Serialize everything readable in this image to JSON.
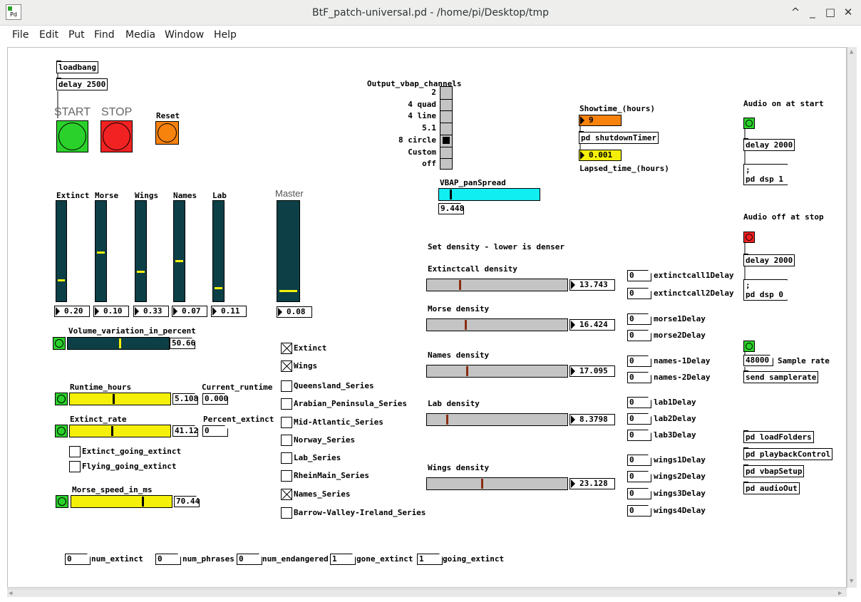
{
  "window": {
    "title": "BtF_patch-universal.pd  - /home/pi/Desktop/tmp",
    "app_icon_label": "Pd",
    "controls": [
      "^",
      "_",
      "□",
      "✕"
    ]
  },
  "menu": [
    "File",
    "Edit",
    "Put",
    "Find",
    "Media",
    "Window",
    "Help"
  ],
  "objects": {
    "loadbang": "loadbang",
    "delay2500": "delay 2500",
    "shutdown": "pd shutdownTimer",
    "delay_on": "delay 2000",
    "delay_off": "delay 2000",
    "send_sr": "send samplerate",
    "loadfolders": "pd loadFolders",
    "playback": "pd playbackControl",
    "vbapsetup": "pd vbapSetup",
    "audioout": "pd audioOut"
  },
  "labels": {
    "start": "START",
    "stop": "STOP",
    "reset": "Reset",
    "master": "Master",
    "output_vbap": "Output_vbap_channels",
    "showtime": "Showtime_(hours)",
    "lapsed": "Lapsed_time_(hours)",
    "audio_on": "Audio on at start",
    "audio_off": "Audio off at stop",
    "sample_rate": "Sample rate",
    "vbap_spread": "VBAP_panSpread",
    "set_density": "Set density - lower is denser",
    "volume_var": "Volume_variation_in_percent",
    "runtime_hours": "Runtime_hours",
    "current_runtime": "Current_runtime",
    "extinct_rate": "Extinct_rate",
    "percent_extinct": "Percent_extinct",
    "morse_speed": "Morse_speed_in_ms",
    "extinct_going": "Extinct_going_extinct",
    "flying_going": "Flying_going_extinct"
  },
  "messages": {
    "dsp_on_1": ";",
    "dsp_on_2": "pd dsp 1",
    "dsp_off_1": ";",
    "dsp_off_2": "pd dsp 0"
  },
  "radio_labels": [
    "2",
    "4 quad",
    "4 line",
    "5.1",
    "8 circle",
    "Custom",
    "off"
  ],
  "radio_selected": 4,
  "showtime_value": "9",
  "lapsed_value": "0.001",
  "vbap_spread_value": "9.448",
  "sample_rate_value": "48000",
  "vsliders": [
    {
      "name": "Extinct",
      "value": "0.20",
      "level": 0.2
    },
    {
      "name": "Morse",
      "value": "0.10",
      "level": 0.49
    },
    {
      "name": "Wings",
      "value": "0.33",
      "level": 0.29
    },
    {
      "name": "Names",
      "value": "0.07",
      "level": 0.4
    },
    {
      "name": "Lab",
      "value": "0.11",
      "level": 0.12
    }
  ],
  "master": {
    "value": "0.08",
    "level": 0.09
  },
  "volume_var_value": "50.66",
  "runtime_value": "5.108",
  "current_runtime_value": "0.000",
  "extinct_rate_value": "41.12",
  "percent_extinct_value": "0",
  "morse_speed_value": "70.44",
  "series": [
    {
      "label": "Extinct",
      "checked": true
    },
    {
      "label": "Wings",
      "checked": true
    },
    {
      "label": "Queensland_Series",
      "checked": false
    },
    {
      "label": "Arabian_Peninsula_Series",
      "checked": false
    },
    {
      "label": "Mid-Atlantic_Series",
      "checked": false
    },
    {
      "label": "Norway_Series",
      "checked": false
    },
    {
      "label": "Lab_Series",
      "checked": false
    },
    {
      "label": "RheinMain_Series",
      "checked": false
    },
    {
      "label": "Names_Series",
      "checked": true
    },
    {
      "label": "Barrow-Valley-Ireland_Series",
      "checked": false
    }
  ],
  "densities": [
    {
      "label": "Extinctcall density",
      "value": "13.743",
      "level": 0.23
    },
    {
      "label": "Morse density",
      "value": "16.424",
      "level": 0.27
    },
    {
      "label": "Names density",
      "value": "17.095",
      "level": 0.28
    },
    {
      "label": "Lab density",
      "value": "8.3798",
      "level": 0.14
    },
    {
      "label": "Wings density",
      "value": "23.128",
      "level": 0.39
    }
  ],
  "delays": [
    {
      "value": "0",
      "label": "extinctcall1Delay"
    },
    {
      "value": "0",
      "label": "extinctcall2Delay"
    },
    {
      "value": "0",
      "label": "morse1Delay"
    },
    {
      "value": "0",
      "label": "morse2Delay"
    },
    {
      "value": "0",
      "label": "names-1Delay"
    },
    {
      "value": "0",
      "label": "names-2Delay"
    },
    {
      "value": "0",
      "label": "lab1Delay"
    },
    {
      "value": "0",
      "label": "lab2Delay"
    },
    {
      "value": "0",
      "label": "lab3Delay"
    },
    {
      "value": "0",
      "label": "wings1Delay"
    },
    {
      "value": "0",
      "label": "wings2Delay"
    },
    {
      "value": "0",
      "label": "wings3Delay"
    },
    {
      "value": "0",
      "label": "wings4Delay"
    }
  ],
  "counters": [
    {
      "value": "0",
      "label": "num_extinct"
    },
    {
      "value": "0",
      "label": "num_phrases"
    },
    {
      "value": "0",
      "label": "num_endangered"
    },
    {
      "value": "1",
      "label": "gone_extinct"
    },
    {
      "value": "1",
      "label": "going_extinct"
    }
  ],
  "colors": {
    "green": "#2bd12b",
    "red": "#f22222",
    "orange": "#f7820c",
    "yellow": "#f4f00a",
    "cyan": "#11eef1",
    "teal": "#0c3f46",
    "grey": "#c4c4c4",
    "orange_num": "#f7820c"
  }
}
